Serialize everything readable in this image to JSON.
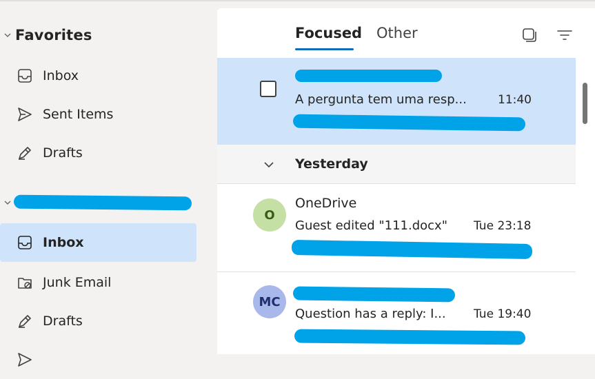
{
  "nav": {
    "favorites": {
      "title": "Favorites",
      "items": [
        {
          "label": "Inbox",
          "icon": "inbox-icon"
        },
        {
          "label": "Sent Items",
          "icon": "send-icon"
        },
        {
          "label": "Drafts",
          "icon": "drafts-icon"
        }
      ]
    },
    "account": {
      "items": [
        {
          "label": "Inbox",
          "icon": "inbox-icon",
          "selected": true
        },
        {
          "label": "Junk Email",
          "icon": "junk-icon"
        },
        {
          "label": "Drafts",
          "icon": "drafts-icon"
        }
      ]
    }
  },
  "mail_list": {
    "tabs": [
      {
        "label": "Focused",
        "active": true
      },
      {
        "label": "Other",
        "active": false
      }
    ],
    "toolbar": {
      "select_icon": "select-mode-icon",
      "filter_icon": "filter-icon"
    },
    "messages": [
      {
        "subject": "A pergunta tem uma resp...",
        "time": "11:40",
        "selected": true
      }
    ],
    "group": {
      "label": "Yesterday"
    },
    "group_messages": [
      {
        "initials": "O",
        "sender": "OneDrive",
        "subject": "Guest edited \"111.docx\"",
        "time": "Tue 23:18",
        "avatar_color": "#c5e0a5",
        "avatar_text_color": "#3a5a1a"
      },
      {
        "initials": "MC",
        "subject": "Question has a reply: I...",
        "time": "Tue 19:40",
        "avatar_color": "#a9b8ea",
        "avatar_text_color": "#1f2f6e"
      }
    ]
  },
  "colors": {
    "accent": "#0f6cbd",
    "selected_bg": "#cfe4fa",
    "redaction": "#00a2e8"
  }
}
